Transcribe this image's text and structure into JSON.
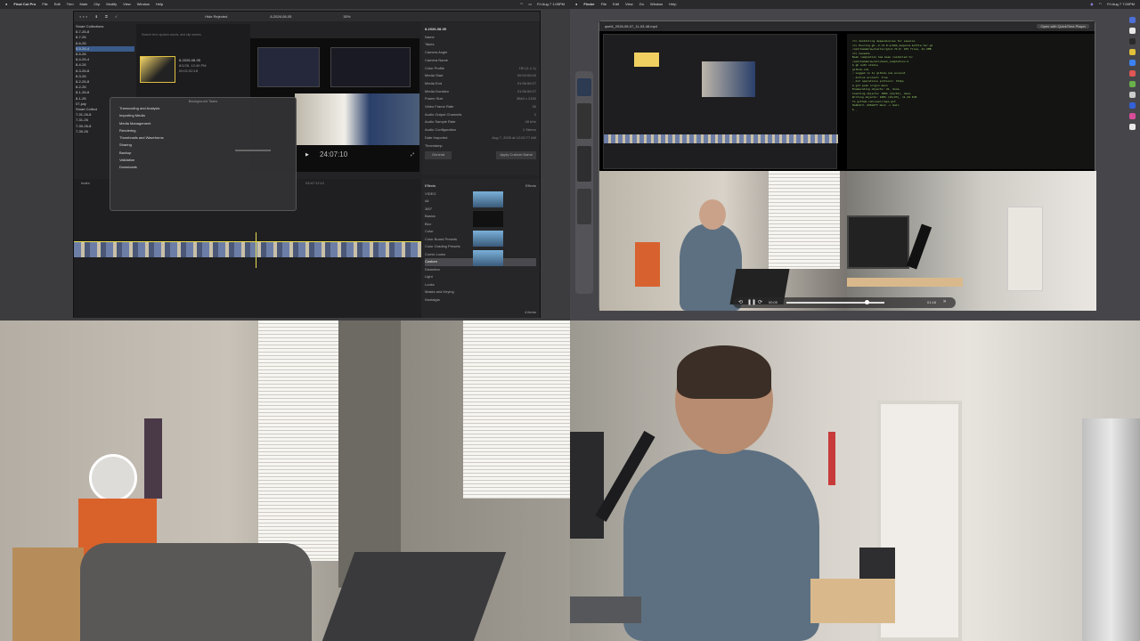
{
  "q1": {
    "menubar": {
      "app": "Final Cut Pro",
      "items": [
        "File",
        "Edit",
        "Trim",
        "Mark",
        "Clip",
        "Modify",
        "View",
        "Window",
        "Help"
      ],
      "clock": "Fri Aug 7 1:05PM"
    },
    "toolbar": {
      "filter": "Hide Rejected",
      "project": "8-2026-08-05",
      "zoom": "30%",
      "viewer_label": "16:9 SD"
    },
    "library": [
      "Smart Collections",
      "8-7-26-8",
      "8-7-26",
      "8-6-26",
      "8-5-26-4",
      "8-5-26",
      "8-4-26-4",
      "8-4-26",
      "8-3-26-8",
      "8-3-26",
      "8-2-26-8",
      "8-2-26",
      "8-1-26-8",
      "8-1-26",
      "07-july",
      "Smart Collect",
      "7-31-26-8",
      "7-31-26",
      "7-30-26-8",
      "7-30-26"
    ],
    "clip": {
      "name": "8-2026-08-05",
      "date": "8/1/26, 12:49 PM",
      "duration": "00:01:52:18"
    },
    "search_placeholder": "Search text, spoken words, and clip names",
    "popup": {
      "title": "Background Tasks",
      "items": [
        "Transcoding and Analysis",
        "Importing Media",
        "Media Management",
        "Rendering",
        "Thumbnails and Waveforms",
        "Sharing",
        "Backup",
        "Validation",
        "Downloads"
      ]
    },
    "timecode": "24:07:10",
    "inspector": {
      "header": "8-2026-08-05",
      "rows": [
        [
          "Name",
          ""
        ],
        [
          "Takes",
          ""
        ],
        [
          "Camera Angle",
          ""
        ],
        [
          "Camera Name",
          ""
        ],
        [
          "Color Profile",
          "HD (1-1-1)"
        ],
        [
          "Media Start",
          "00:00:00:00"
        ],
        [
          "Media End",
          "01:56:59:27"
        ],
        [
          "Media Duration",
          "01:56:59:27"
        ],
        [
          "Frame Size",
          "3840 x 2160"
        ],
        [
          "Video Frame Rate",
          "30"
        ],
        [
          "Audio Output Channels",
          "2"
        ],
        [
          "Audio Sample Rate",
          "48 kHz"
        ],
        [
          "Audio Configuration",
          "1 Stereo"
        ],
        [
          "Date Imported",
          "Aug 7, 2026 at 12:02:77 AM"
        ],
        [
          "Timestamp",
          ""
        ]
      ],
      "buttons": [
        "General",
        "Apply Custom Name"
      ]
    },
    "timeline": {
      "label": "Index",
      "duration": "03:47:12:12"
    },
    "effects": {
      "title": "Effects",
      "filter": "Effects",
      "categories": [
        "VIDEO",
        "All",
        "360°",
        "Basics",
        "Blur",
        "Color",
        "Color Board Presets",
        "Color Grading Presets",
        "Comic Looks",
        "Custom",
        "Distortion",
        "Light",
        "Looks",
        "Masks and Keying",
        "Nostalgia"
      ],
      "selected": "Custom",
      "thumbs": [
        "Split",
        "Crossfade Sep",
        "Shadow",
        "simple shade"
      ],
      "count": "4 items"
    }
  },
  "q2": {
    "menubar": {
      "app": "Finder",
      "items": [
        "File",
        "Edit",
        "View",
        "Go",
        "Window",
        "Help"
      ],
      "clock": "Fri Aug 7 7:00PM"
    },
    "player": {
      "title": "qsel4_2026-08-07_11-03-48.mp4",
      "open_button": "Open with QuickTime Player",
      "time_left": "00:00",
      "time_right": "01:18"
    },
    "terminal": [
      "==> Installing dependencies for session",
      "==> Pouring gh--2.74.0.arm64_sequoia.bottle.tar.gz",
      "/opt/homebrew/Cellar/gh/2.74.0: 253 files, 41.2MB",
      "==> Caveats",
      "Bash completion has been installed to:",
      "  /opt/homebrew/etc/bash_completion.d",
      "$ gh auth status",
      "github.com",
      "  ✓ Logged in to github.com account",
      "  - Active account: true",
      "  - Git operations protocol: https",
      "$ git push origin main",
      "Enumerating objects: 41, done.",
      "Counting objects: 100% (41/41), done.",
      "Writing objects: 100% (23/23), 11.44 KiB",
      "To github.com:user/repo.git",
      "   9a1b2c3..4d5e6f7  main -> main",
      "$ _"
    ]
  }
}
